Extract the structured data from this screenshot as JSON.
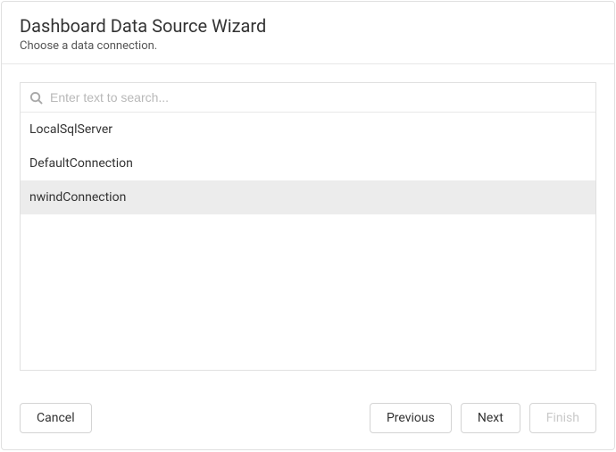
{
  "header": {
    "title": "Dashboard Data Source Wizard",
    "subtitle": "Choose a data connection."
  },
  "search": {
    "placeholder": "Enter text to search...",
    "value": ""
  },
  "connections": {
    "items": [
      {
        "label": "LocalSqlServer",
        "selected": false
      },
      {
        "label": "DefaultConnection",
        "selected": false
      },
      {
        "label": "nwindConnection",
        "selected": true
      }
    ]
  },
  "footer": {
    "cancel": "Cancel",
    "previous": "Previous",
    "next": "Next",
    "finish": "Finish"
  }
}
